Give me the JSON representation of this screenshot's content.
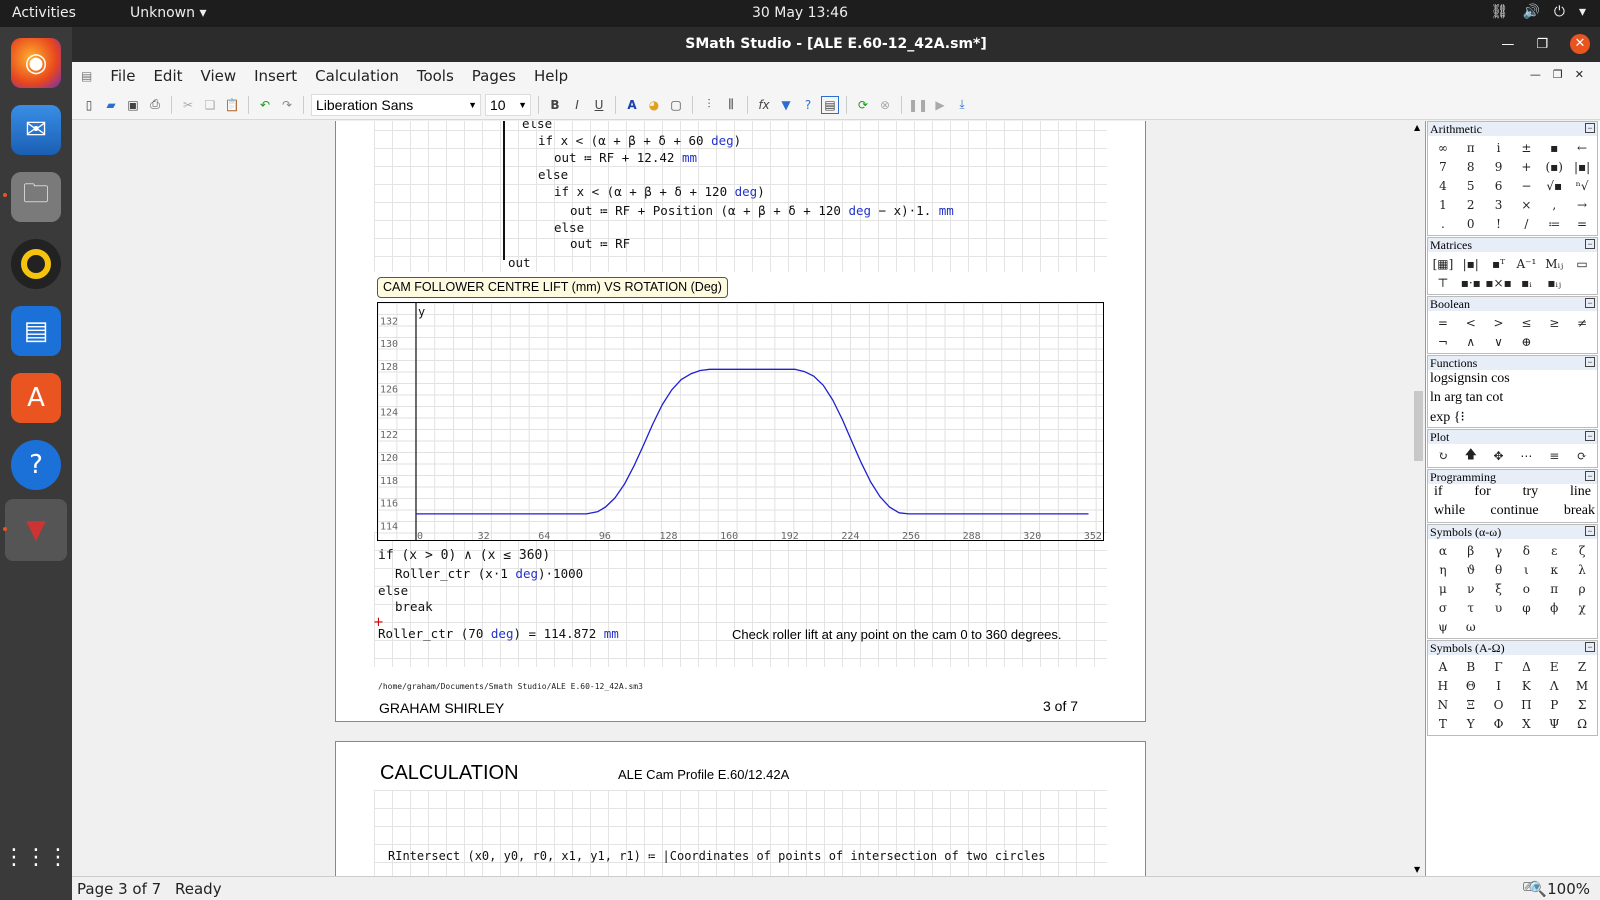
{
  "topbar": {
    "activities": "Activities",
    "app_menu": "Unknown",
    "clock": "30 May  13:46"
  },
  "window": {
    "title": "SMath Studio - [ALE E.60-12_42A.sm*]"
  },
  "menu": [
    "File",
    "Edit",
    "View",
    "Insert",
    "Calculation",
    "Tools",
    "Pages",
    "Help"
  ],
  "toolbar": {
    "font_name": "Liberation Sans",
    "font_size": "10"
  },
  "code_top": {
    "else1": "else",
    "if1": "if x < (α + β + δ + 60 ",
    "deg": "deg",
    "out1": "out ≔ RF + 12.42 ",
    "mm": "mm",
    "else2": "else",
    "if2": "if x < (α + β + δ + 120 ",
    "out2a": "out ≔ RF + Position (α + β + δ + 120 ",
    "out2b": " − x)·1. ",
    "else3": "else",
    "out3": "out ≔ RF",
    "out": "out"
  },
  "plot_label": "CAM FOLLOWER CENTRE LIFT (mm) VS ROTATION (Deg)",
  "chart_data": {
    "type": "line",
    "title": "CAM FOLLOWER CENTRE LIFT (mm) VS ROTATION (Deg)",
    "ylabel": "y",
    "xlim": [
      0,
      360
    ],
    "ylim": [
      113.5,
      133
    ],
    "x_ticks": [
      0,
      32,
      64,
      96,
      128,
      160,
      192,
      224,
      256,
      288,
      320,
      352
    ],
    "y_ticks": [
      114,
      116,
      118,
      120,
      122,
      124,
      126,
      128,
      130,
      132
    ],
    "grid": true,
    "series": [
      {
        "color": "#1f1fd0",
        "x": [
          0,
          30,
          60,
          90,
          96,
          100,
          105,
          110,
          115,
          120,
          125,
          130,
          135,
          140,
          145,
          150,
          155,
          160,
          165,
          170,
          180,
          190,
          200,
          205,
          210,
          215,
          220,
          225,
          230,
          235,
          240,
          245,
          250,
          255,
          260,
          270,
          300,
          340,
          355
        ],
        "y": [
          115.0,
          115.0,
          115.0,
          115.0,
          115.2,
          115.6,
          116.4,
          117.6,
          119.2,
          121.0,
          122.9,
          124.6,
          125.9,
          126.8,
          127.3,
          127.6,
          127.7,
          127.7,
          127.7,
          127.7,
          127.7,
          127.7,
          127.7,
          127.5,
          127.1,
          126.3,
          125.0,
          123.3,
          121.4,
          119.5,
          117.8,
          116.5,
          115.6,
          115.1,
          115.0,
          115.0,
          115.0,
          115.0,
          115.0
        ]
      }
    ]
  },
  "code_bottom": {
    "if": "if (x > 0) ∧ (x ≤ 360)",
    "call_a": "Roller_ctr (x·1 ",
    "deg": "deg",
    "call_b": ")·1000",
    "else": "else",
    "break": "break",
    "eval_a": "Roller_ctr (70 ",
    "eval_b": ") = 114.872 ",
    "mm": "mm",
    "note": "Check roller lift at any point on the cam 0 to 360 degrees."
  },
  "footer": {
    "path": "/home/graham/Documents/Smath Studio/ALE E.60-12_42A.sm3",
    "author": "GRAHAM SHIRLEY",
    "page_num": "3 of 7"
  },
  "next_page": {
    "heading": "CALCULATION",
    "subtitle": "ALE Cam Profile E.60/12.42A",
    "cut_line": "RIntersect (x0, y0, r0, x1, y1, r1) ≔ |Coordinates of points of intersection of two circles"
  },
  "panels": {
    "arithmetic": {
      "title": "Arithmetic",
      "keys": [
        "∞",
        "π",
        "i",
        "±",
        "▪",
        "←",
        "7",
        "8",
        "9",
        "+",
        "(▪)",
        "|▪|",
        "4",
        "5",
        "6",
        "−",
        "√▪",
        "ⁿ√",
        "1",
        "2",
        "3",
        "×",
        ",",
        "→",
        ".",
        "0",
        "!",
        "/",
        "≔",
        "="
      ]
    },
    "matrices": {
      "title": "Matrices",
      "keys": [
        "[▦]",
        "|▪|",
        "▪ᵀ",
        "A⁻¹",
        "Mᵢⱼ",
        "▭",
        "⊤",
        "▪·▪",
        "▪×▪",
        "▪ᵢ",
        "▪ᵢⱼ",
        ""
      ]
    },
    "boolean": {
      "title": "Boolean",
      "keys": [
        "=",
        "<",
        ">",
        "≤",
        "≥",
        "≠",
        "¬",
        "∧",
        "∨",
        "⊕",
        "",
        ""
      ]
    },
    "functions": {
      "title": "Functions",
      "row1": "logsignsin cos",
      "row2": "ln  arg tan cot",
      "row3": "exp {⁝"
    },
    "plot": {
      "title": "Plot",
      "keys": [
        "↻",
        "🡅",
        "✥",
        "⋯",
        "≡",
        "⟳"
      ]
    },
    "programming": {
      "title": "Programming",
      "row1": [
        "if",
        "for",
        "try",
        "line"
      ],
      "row2": [
        "while",
        "continue",
        "break"
      ]
    },
    "greek_lower": {
      "title": "Symbols (α-ω)",
      "keys": [
        "α",
        "β",
        "γ",
        "δ",
        "ε",
        "ζ",
        "η",
        "ϑ",
        "θ",
        "ι",
        "κ",
        "λ",
        "μ",
        "ν",
        "ξ",
        "ο",
        "π",
        "ρ",
        "σ",
        "τ",
        "υ",
        "φ",
        "ϕ",
        "χ",
        "ψ",
        "ω",
        "",
        "",
        "",
        ""
      ]
    },
    "greek_upper": {
      "title": "Symbols (A-Ω)",
      "keys": [
        "A",
        "B",
        "Γ",
        "Δ",
        "E",
        "Z",
        "H",
        "Θ",
        "I",
        "K",
        "Λ",
        "M",
        "N",
        "Ξ",
        "O",
        "Π",
        "P",
        "Σ",
        "T",
        "Y",
        "Φ",
        "X",
        "Ψ",
        "Ω"
      ]
    }
  },
  "status": {
    "page": "Page 3 of 7",
    "state": "Ready",
    "zoom": "100%"
  }
}
